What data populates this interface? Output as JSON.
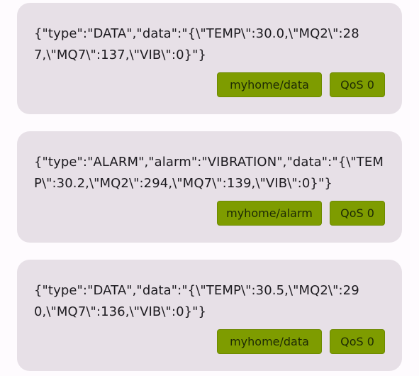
{
  "messages": [
    {
      "payload": "{\"type\":\"DATA\",\"data\":\"{\\\"TEMP\\\":30.0,\\\"MQ2\\\":287,\\\"MQ7\\\":137,\\\"VIB\\\":0}\"}",
      "topic": "myhome/data",
      "qos": "QoS 0"
    },
    {
      "payload": "{\"type\":\"ALARM\",\"alarm\":\"VIBRATION\",\"data\":\"{\\\"TEMP\\\":30.2,\\\"MQ2\\\":294,\\\"MQ7\\\":139,\\\"VIB\\\":0}\"}",
      "topic": "myhome/alarm",
      "qos": "QoS 0"
    },
    {
      "payload": "{\"type\":\"DATA\",\"data\":\"{\\\"TEMP\\\":30.5,\\\"MQ2\\\":290,\\\"MQ7\\\":136,\\\"VIB\\\":0}\"}",
      "topic": "myhome/data",
      "qos": "QoS 0"
    }
  ],
  "colors": {
    "background": "#fefbfe",
    "card": "#e7e0e7",
    "chip": "#7e9c00",
    "text": "#1d1b20"
  }
}
